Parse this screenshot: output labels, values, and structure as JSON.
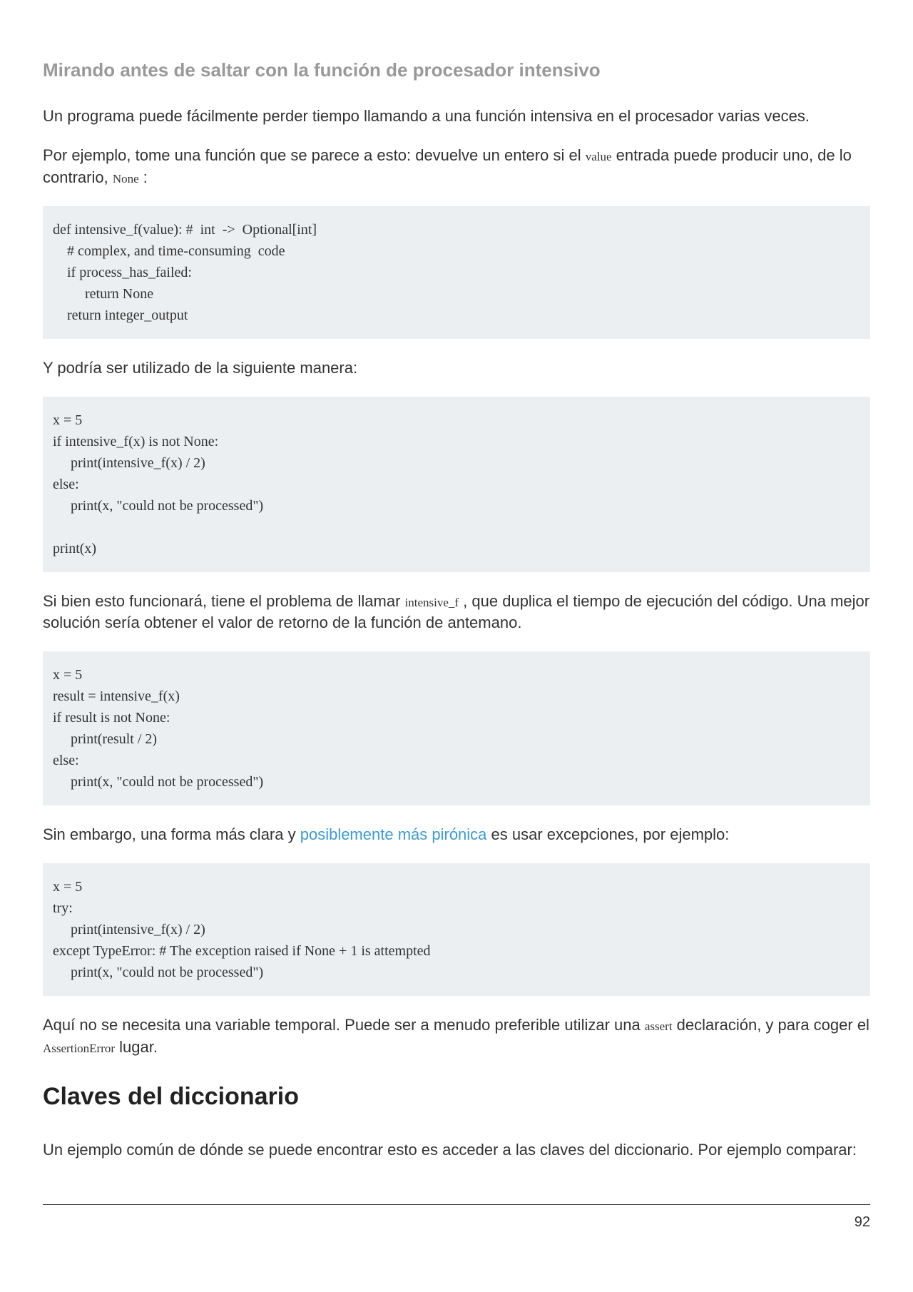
{
  "section_title": "Mirando antes de saltar con la función de procesador intensivo",
  "para1_a": "Un programa puede fácilmente perder tiempo llamando a una función intensiva en el procesador varias veces.",
  "para2_a": "Por ejemplo, tome una función que se parece a esto: devuelve un entero si el ",
  "para2_code1": "value",
  "para2_b": " entrada puede producir uno, de lo contrario, ",
  "para2_code2": "None",
  "para2_c": " :",
  "code1": "def intensive_f(value): #  int  ->  Optional[int]\n    # complex, and time-consuming  code\n    if process_has_failed:\n         return None\n    return integer_output",
  "para3": "Y podría ser utilizado de la siguiente manera:",
  "code2": "x = 5\nif intensive_f(x) is not None:\n     print(intensive_f(x) / 2)\nelse:\n     print(x, \"could not be processed\")\n \nprint(x)",
  "para4_a": "Si bien esto funcionará, tiene el problema de llamar ",
  "para4_code1": "intensive_f",
  "para4_b": " , que duplica el tiempo de ejecución del código. Una mejor solución sería obtener el valor de retorno de la función de antemano.",
  "code3": "x = 5\nresult = intensive_f(x)\nif result is not None:\n     print(result / 2)\nelse:\n     print(x, \"could not be processed\")",
  "para5_a": "Sin embargo, una forma más clara y ",
  "para5_link": "posiblemente más pirónica",
  "para5_b": " es usar excepciones, por ejemplo:",
  "code4": "x = 5\ntry:\n     print(intensive_f(x) / 2)\nexcept TypeError: # The exception raised if None + 1 is attempted\n     print(x, \"could not be processed\")",
  "para6_a": "Aquí no se necesita una variable temporal. Puede ser a menudo preferible utilizar una ",
  "para6_code1": "assert",
  "para6_b": " declaración, y para coger el ",
  "para6_code2": "AssertionError",
  "para6_c": " lugar.",
  "heading2": "Claves del diccionario",
  "para7": "Un ejemplo común de dónde se puede encontrar esto es acceder a las claves del diccionario. Por ejemplo comparar:",
  "page_number": "92"
}
